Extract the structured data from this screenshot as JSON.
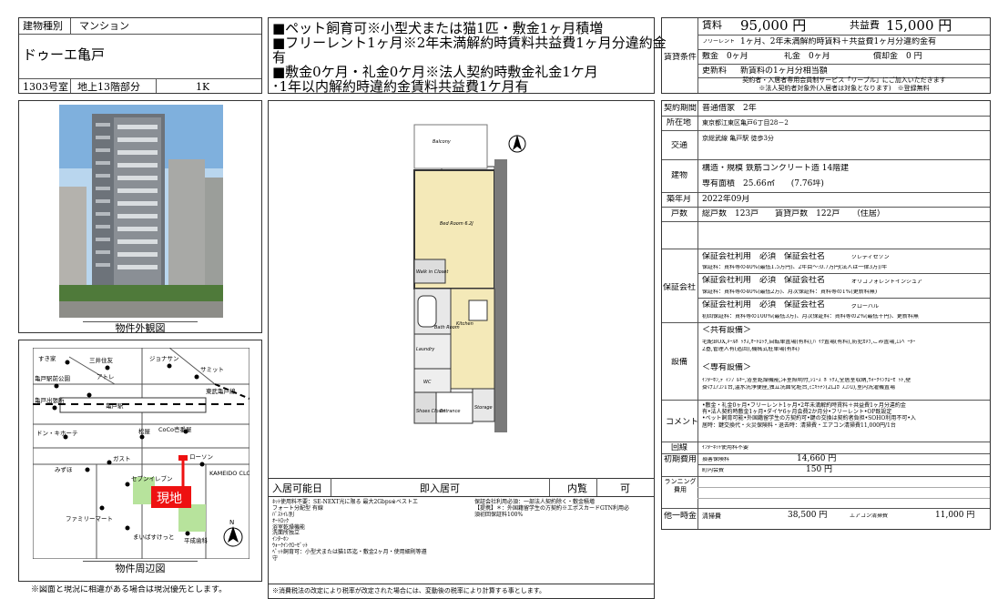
{
  "header": {
    "type_label": "建物種別",
    "type_value": "マンション",
    "building_name": "ドゥーエ亀戸",
    "room": "1303号室",
    "floor": "地上13階部分",
    "layout": "1K"
  },
  "headline": [
    "■ペット飼育可※小型犬または猫1匹・敷金1ヶ月積増",
    "■フリーレント1ヶ月※2年未満解約時賃料共益費1ヶ月分違約金",
    "有",
    "■敷金0ケ月・礼金0ケ月※法人契約時敷金礼金1ケ月",
    "･1年以内解約時違約金賃料共益費1ケ月有"
  ],
  "rent": {
    "section_label": "賃貸条件",
    "rent_label": "賃料",
    "rent_value": "95,000 円",
    "common_label": "共益費",
    "common_value": "15,000 円",
    "freerent_label": "フリーレント",
    "freerent_value": "1ヶ月、2年未満解約時賃料＋共益費1ヶ月分違約金有",
    "deposit": "敷金　0ヶ月",
    "key_money": "礼金　0ヶ月",
    "amortize": "償却金　0 円",
    "renewal_label": "更新料",
    "renewal_value": "新賃料の1ヶ月分相当額",
    "note1": "契約者・入居者専用会員制サービス「リーブル」にご加入いただきます",
    "note2": "※法人契約者対象外(入居者は対象となります)　※登録無料"
  },
  "details": {
    "contract_label": "契約期間",
    "contract_value": "普通借家　2年",
    "address_label": "所在地",
    "address_value": "東京都江東区亀戸6丁目28－2",
    "traffic_label": "交通",
    "traffic_value": "京総武線 亀戸駅 徒歩3分",
    "building_label": "建物",
    "structure": "構造・規模 鉄筋コンクリート造 14階建",
    "area": "専有面積　25.66㎡　　(7.76坪)",
    "built_label": "築年月",
    "built_value": "2022年09月",
    "units_label": "戸数",
    "units_value": "総戸数　123戸　　賃貸戸数　122戸　　（住居）",
    "guarantee_label": "保証会社",
    "g1_head": "保証会社利用　必須　保証会社名",
    "g1_name": "クレディセゾン",
    "g1_note": "保証料：賃料等の40%(最低1.5万円)、2年目～:0.7万円(法人は一律3万)/年",
    "g2_head": "保証会社利用　必須　保証会社名",
    "g2_name": "オリコフォレントインシュア",
    "g2_note": "保証料：賃料等の40%(最低2万)、月次保証料：賃料等の1%(更新料無)",
    "g3_head": "保証会社利用　必須　保証会社名",
    "g3_name": "グローバル",
    "g3_note": "初回保証料：賃料等の100%(最低3万)、月次保証料：賃料等の2%(最低千円)、更新料無",
    "equip_label": "設備",
    "common_equip_head": "＜共有設備＞",
    "common_equip_text1": "宅配BOX,ﾒｰﾙﾎﾞｯｸｽ,ｵｰﾄﾛｯｸ,自転車置場(有料),ﾊﾞｲｸ置場(有料),防犯ｶﾒﾗ,ごみ置場,ｴﾚﾍﾞｰﾀｰ",
    "common_equip_text2": "2基,管理人有(巡回),機械式駐車場(有料)",
    "private_equip_head": "＜専有設備＞",
    "private_equip_text1": "ｲﾝﾀｰﾎﾝ,ﾃﾞｨﾝﾌﾟﾙｷｰ,浴室乾燥機能,洋室照明付,ｼｭｰｽﾞﾎﾞｯｸｽ,全居室収納,ｳｫｰｸｲﾝｸﾛｰｾﾞｯﾄ,壁",
    "private_equip_text2": "掛けｴｱｺﾝ1台,温水洗浄便座,独立洗面化粧台,ﾐﾆｷｯﾁﾝ(2口ｶﾞｽｺﾝﾛ),室内洗濯機置場",
    "comment_label": "コメント",
    "comment_lines": [
      "•敷金・礼金0ヶ月•フリーレント1ヶ月•2年未満解約時賃料＋共益費1ヶ月分違約金",
      "有•法人契約時敷金1ヶ月•ダイヤ6ヶ月会費2か月分•フリーレント•OP既設定",
      "•ペット飼育可能•外国籍留学生の方契約可•鍵の交換は契約者負担•SOHO利用不可•入",
      "居時：鍵交換代・火災保険料・退去時：清掃費・エアコン清掃費11,000円/1台"
    ],
    "line_label": "回線",
    "line_value": "ｲﾝﾀｰﾈｯﾄ使用料不要",
    "initial_label": "初期費用",
    "ins_label": "損害保険料",
    "ins_value": "14,660 円",
    "town_label": "町内会費",
    "town_value": "150 円",
    "running_label": "ランニング\n費用",
    "onetime_label": "他一時金",
    "clean_label": "清掃費",
    "clean_value": "38,500 円",
    "ac_label": "エアコン清掃費",
    "ac_value": "11,000 円"
  },
  "photo": {
    "caption": "物件外観図"
  },
  "map": {
    "caption": "物件周辺図",
    "labels": [
      "すき家",
      "三井住友",
      "ジョナサン",
      "サミット",
      "アトレ",
      "亀戸駅前公園",
      "東武亀戸線",
      "亀戸出張所",
      "亀戸駅",
      "ドン・キホーテ",
      "CoCo壱番屋",
      "松屋",
      "ガスト",
      "ローソン",
      "みずほ",
      "セブンイレブン",
      "KAMEIDO CLOCK",
      "ファミリーマート",
      "まいばすけっと",
      "平成歯科"
    ],
    "here_label": "現地"
  },
  "plan": {
    "rooms": [
      "Balcony",
      "Bed Room 6.2J",
      "Walk in Closet",
      "Kitchen",
      "Bath Room",
      "Laundry",
      "Shoes Closet",
      "Entrance",
      "Storage",
      "WC"
    ]
  },
  "bottom": {
    "move_label": "入居可能日",
    "move_value": "即入居可",
    "view_label": "内覧",
    "view_value": "可",
    "left_notes": [
      "ﾈｯﾄ使用料不要：SE-NEXT光に限る 最大2Gbps※ベストエ",
      "フォート分配型 有線",
      "ﾊﾞｽﾄｲﾚ別",
      "ｵｰﾄﾛｯｸ",
      "浴室乾燥機能",
      "洗面所独立",
      "ｲﾝﾀｰﾎﾝ",
      "ｳｫｰｸｲﾝｸﾛｰｾﾞｯﾄ",
      "ﾍﾟｯﾄ飼育可：小型犬または猫1匹迄・敷金2ヶ月・使用細則等遵",
      "守"
    ],
    "right_notes": [
      "保証会社利用必須：一部法人契約除く・敷金積増",
      "【提携】＊：外国籍留学生の方契約※エポスカードGTN利用必",
      "須初回保証料100%"
    ],
    "tax_note": "※消費税法の改定により税率が改定された場合には、変動後の税率により計算する事とします。",
    "left_note": "※図面と現況に相違がある場合は現況優先とします。"
  }
}
